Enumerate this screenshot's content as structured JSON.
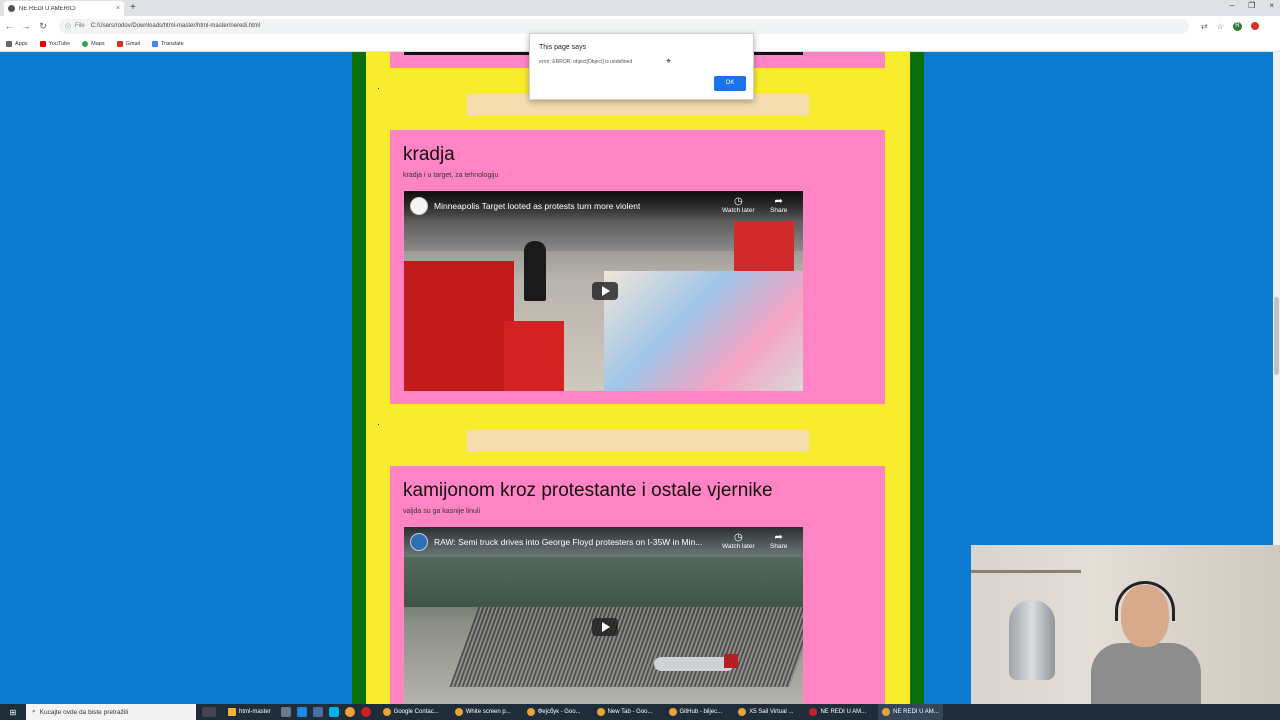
{
  "browser": {
    "tab_title": "NE REDI U AMERICI",
    "tab_close": "×",
    "new_tab": "+",
    "window_controls": [
      "–",
      "❐",
      "×"
    ],
    "address_label": "File",
    "address": "C:/Users/rodov/Downloads/html-master/html-master/neredi.html",
    "bookmarks": [
      "Apps",
      "YouTube",
      "Maps",
      "Gmail",
      "Translate"
    ],
    "profile_initial": "R"
  },
  "alert": {
    "title": "This page says",
    "message": "error: ERROR: object[Object] is undefined",
    "ok_label": "OK"
  },
  "cards": [
    {
      "title": "kradja",
      "subtitle": "kradja i u target, za tehnologiju",
      "video": {
        "title": "Minneapolis Target looted as protests turn more violent",
        "watch_later": "Watch later",
        "share": "Share"
      }
    },
    {
      "title": "kamijonom kroz protestante i ostale vjernike",
      "subtitle": "valjda su ga kasnije linuli",
      "video": {
        "title": "RAW: Semi truck drives into George Floyd protesters on I-35W in Min...",
        "watch_later": "Watch later",
        "share": "Share"
      }
    }
  ],
  "taskbar": {
    "search_placeholder": "Kucajte ovde da biste pretražili",
    "apps": [
      "html-master",
      "Google Contac...",
      "White screen p...",
      "Фејсбук - Goo...",
      "New Tab - Goo...",
      "GitHub - biljec...",
      "X5 Sail Virtual ...",
      "NE REDI U AM...",
      "NE REDI U AM..."
    ]
  },
  "colors": {
    "page_background": "#0a7bd1",
    "green_border": "#0a6e0a",
    "yellow_column": "#f9ec2e",
    "card_pink": "#ff84c4",
    "pale_strip": "#f5ddb0",
    "ok_button": "#1a73e8"
  }
}
